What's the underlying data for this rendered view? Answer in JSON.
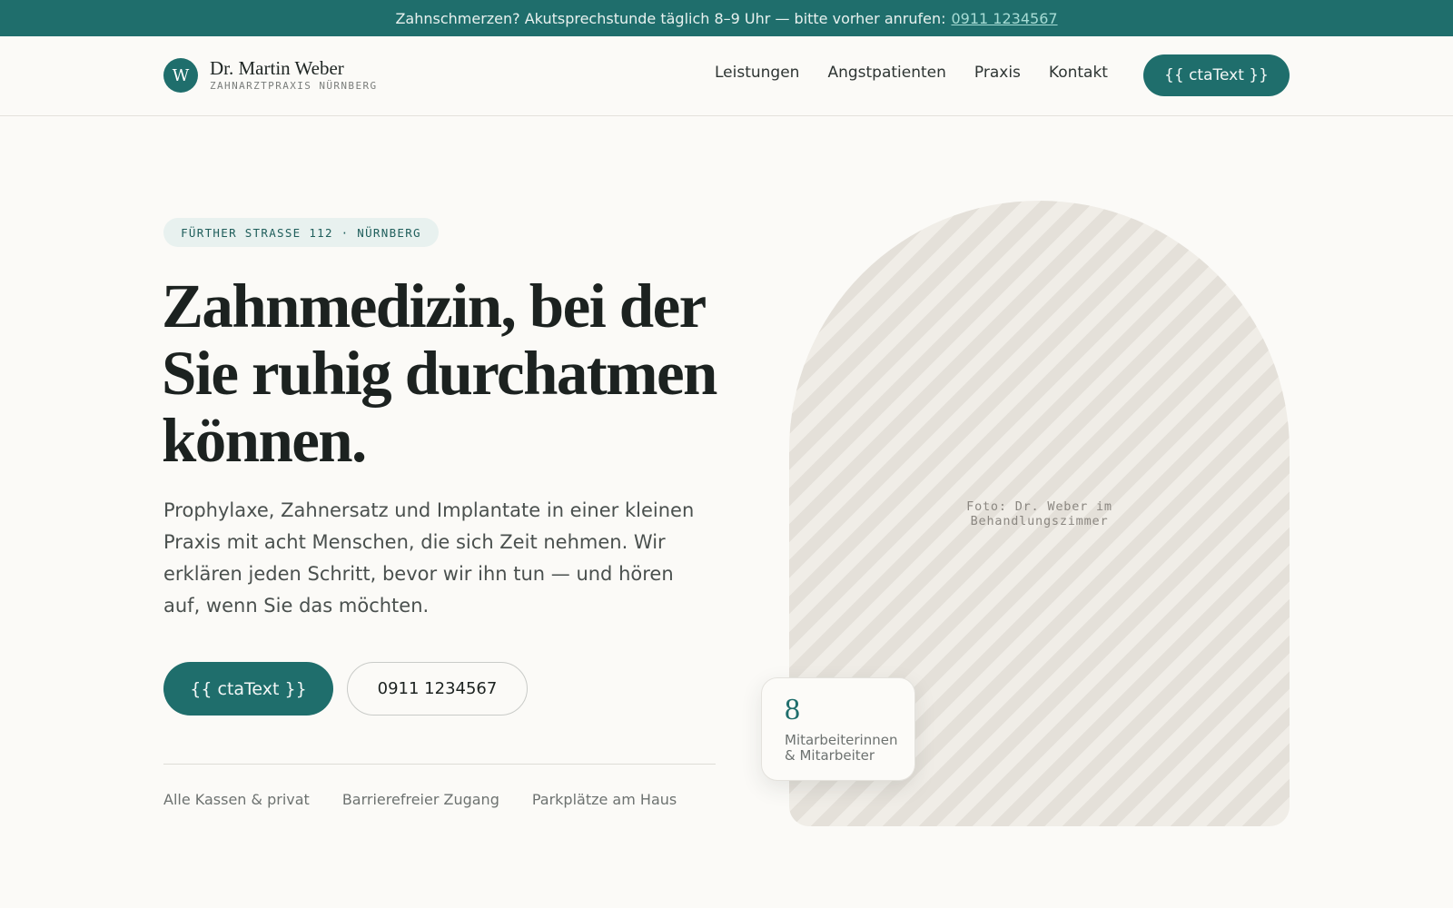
{
  "topbar": {
    "message": "Zahnschmerzen? Akutsprechstunde täglich 8–9 Uhr — bitte vorher anrufen:",
    "phone": "0911 1234567"
  },
  "header": {
    "logo_letter": "W",
    "name": "Dr. Martin Weber",
    "subtitle": "ZAHNARZTPRAXIS NÜRNBERG",
    "nav": [
      "Leistungen",
      "Angstpatienten",
      "Praxis",
      "Kontakt"
    ],
    "cta_label": "{{ ctaText }}"
  },
  "hero": {
    "address": "FÜRTHER STRASSE 112 · NÜRNBERG",
    "title": "Zahnmedizin, bei der Sie ruhig durchatmen können.",
    "text": "Prophylaxe, Zahnersatz und Implantate in einer kleinen Praxis mit acht Menschen, die sich Zeit nehmen. Wir erklären jeden Schritt, bevor wir ihn tun — und hören auf, wenn Sie das möchten.",
    "cta_label": "{{ ctaText }}",
    "phone_label": "0911 1234567",
    "features": [
      "Alle Kassen & privat",
      "Barrierefreier Zugang",
      "Parkplätze am Haus"
    ]
  },
  "photo": {
    "caption_line1": "Foto: Dr. Weber im",
    "caption_line2": "Behandlungszimmer"
  },
  "stat": {
    "number": "8",
    "label_line1": "Mitarbeiterinnen",
    "label_line2": "& Mitarbeiter"
  },
  "colors": {
    "brand": "#1f6e6c",
    "background": "#fbfaf7",
    "pill_bg": "#e8f1ef"
  }
}
